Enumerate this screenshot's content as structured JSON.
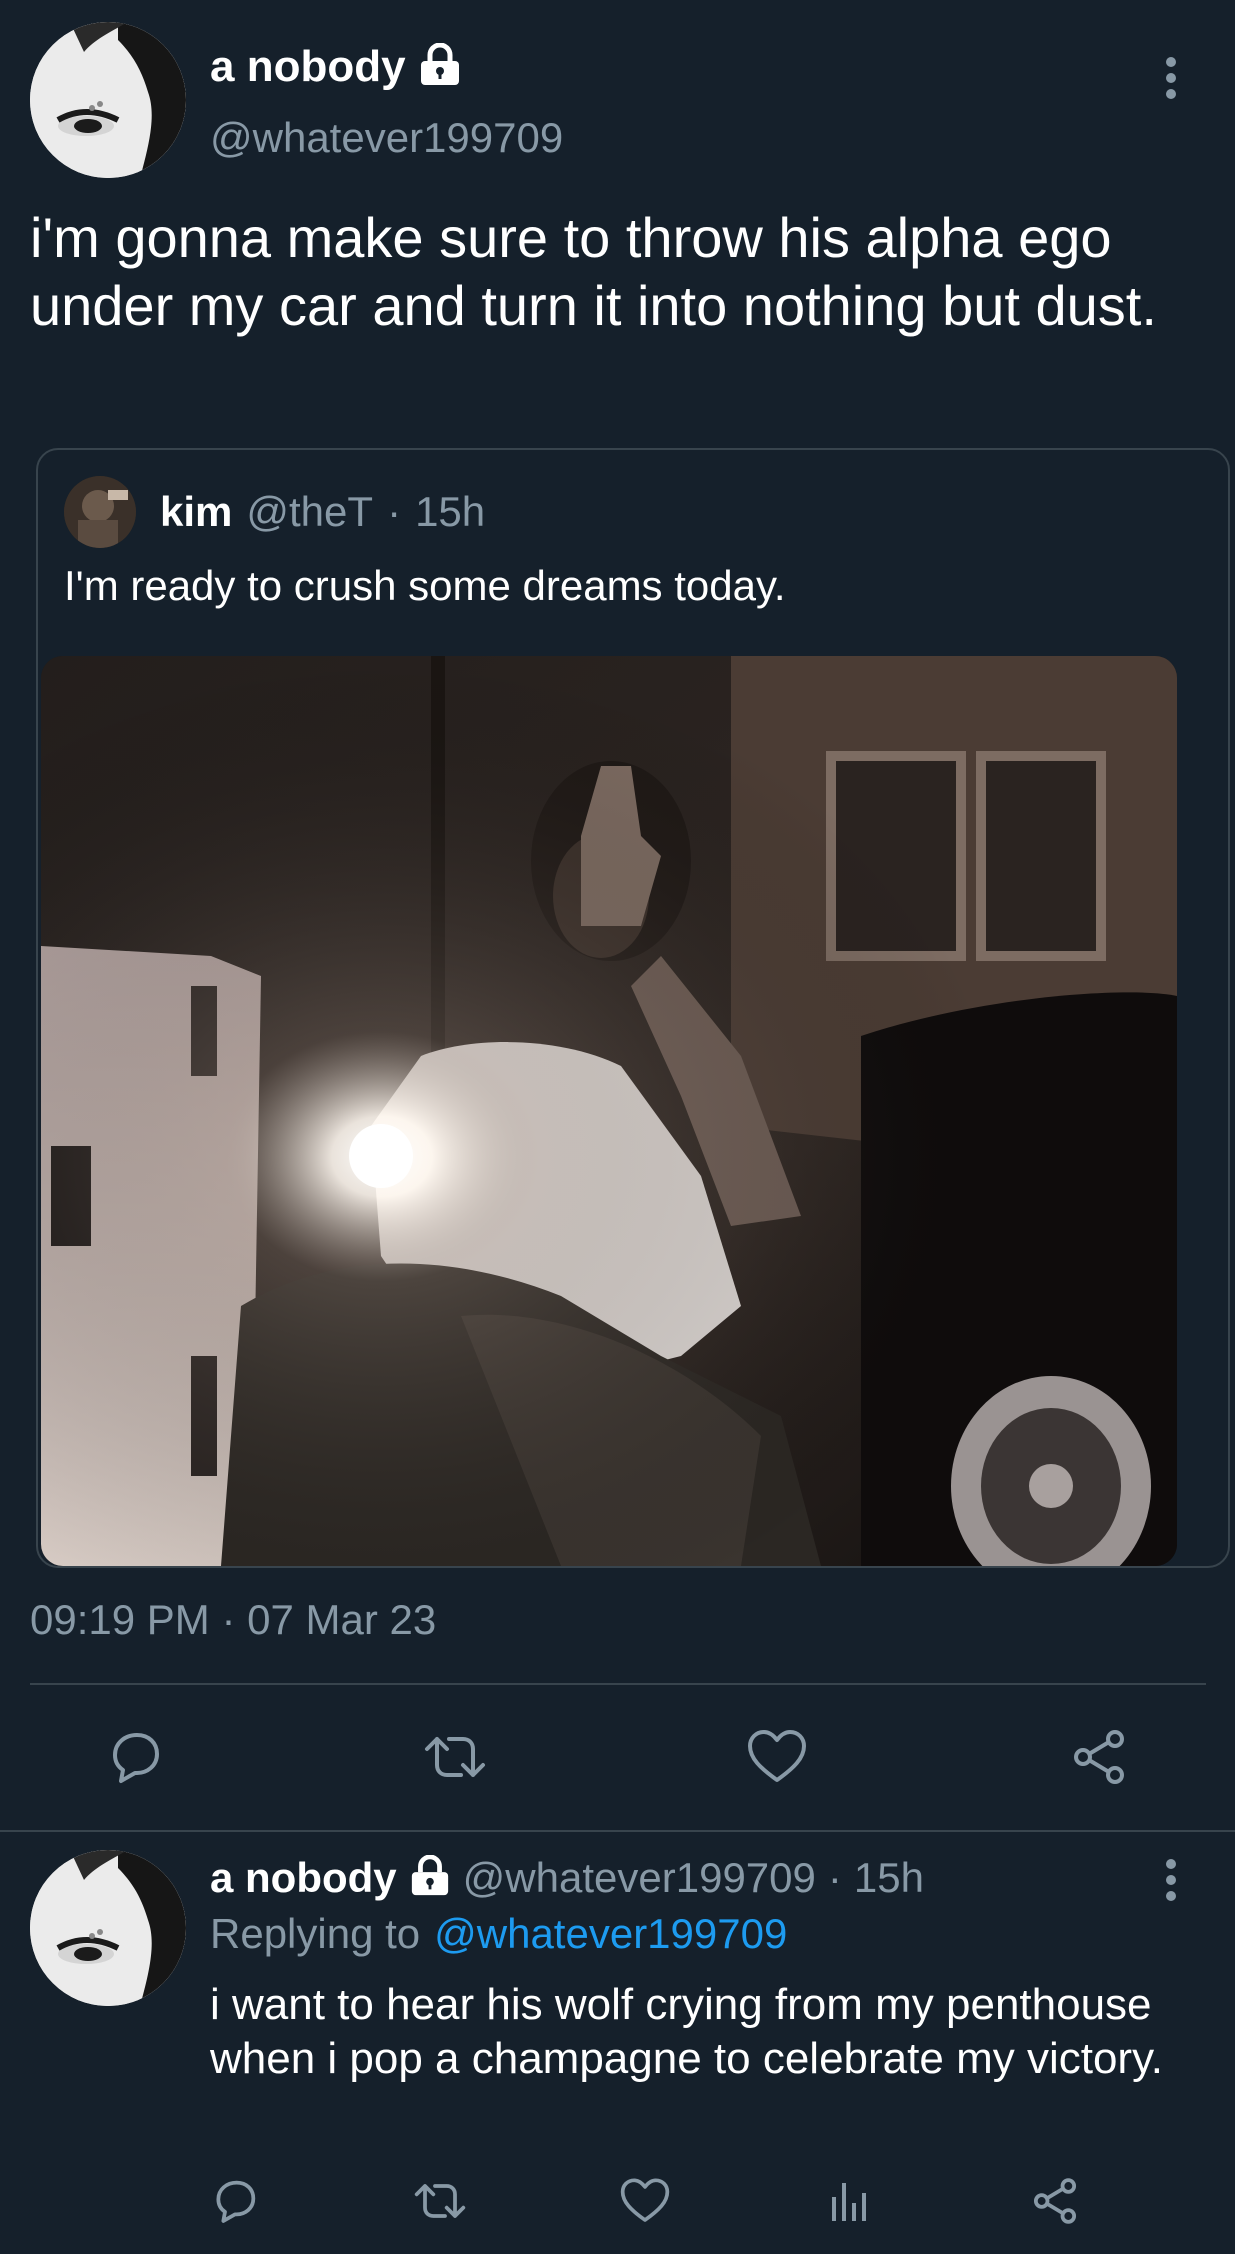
{
  "main_tweet": {
    "display_name": "a nobody",
    "handle": "@whatever199709",
    "text": "i'm gonna make sure to throw his alpha ego under my car and turn it into nothing but dust.",
    "quote": {
      "display_name": "kim",
      "handle": "@theT",
      "separator": "·",
      "time": "15h",
      "text": "I'm ready to crush some dreams today."
    },
    "timestamp": "09:19 PM · 07 Mar 23",
    "actions": [
      "reply-icon",
      "retweet-icon",
      "like-icon",
      "share-icon"
    ]
  },
  "reply_tweet": {
    "display_name": "a nobody",
    "handle": "@whatever199709",
    "separator": "·",
    "time": "15h",
    "replying_prefix": "Replying to",
    "replying_to": "@whatever199709",
    "text": "i want to hear his wolf crying from my penthouse when i pop a champagne to celebrate my victory.",
    "actions": [
      "reply-icon",
      "retweet-icon",
      "like-icon",
      "analytics-icon",
      "share-icon"
    ]
  },
  "colors": {
    "background": "#15202b",
    "text": "#ffffff",
    "muted": "#8899a6",
    "link": "#1d9bf0",
    "border": "#38444d"
  }
}
